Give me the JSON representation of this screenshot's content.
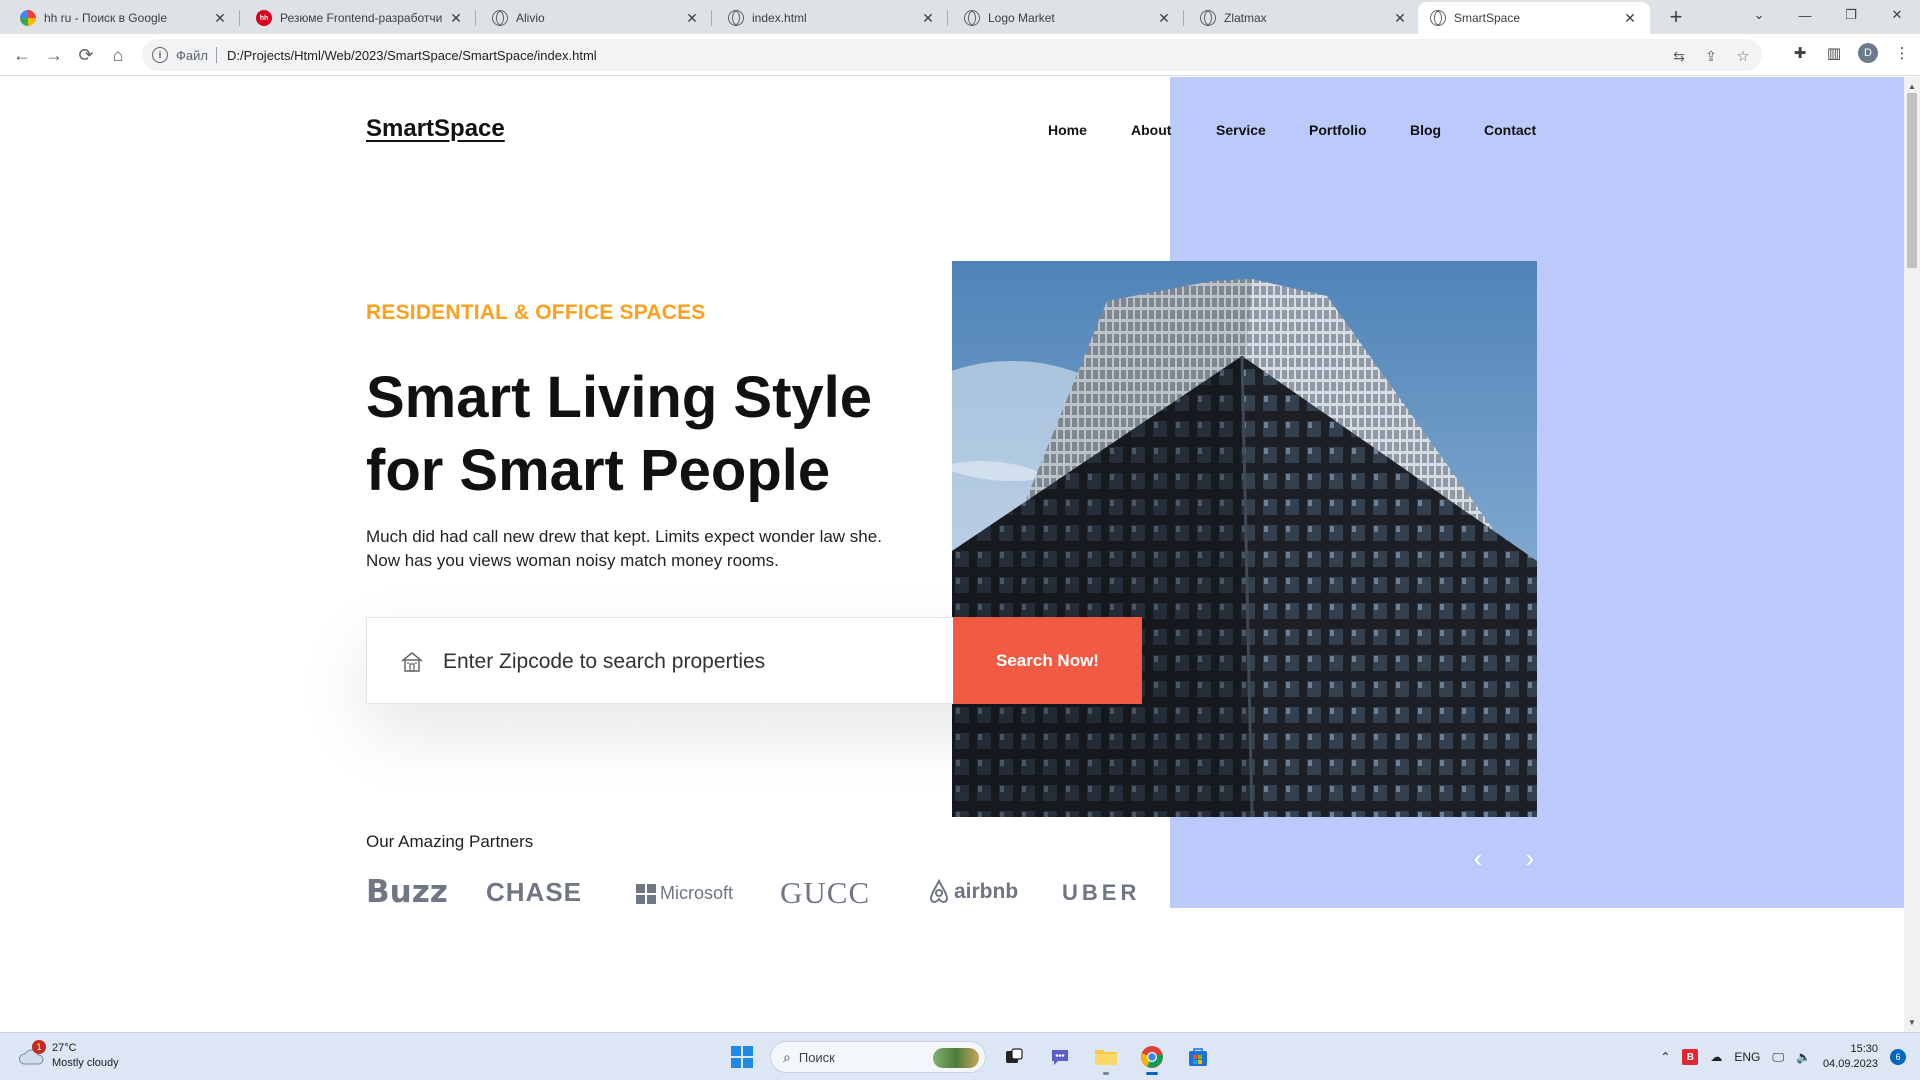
{
  "browser": {
    "tabs": [
      {
        "title": "hh ru - Поиск в Google",
        "favicon": "google"
      },
      {
        "title": "Резюме Frontend-разработчик",
        "favicon": "hh"
      },
      {
        "title": "Alivio",
        "favicon": "globe"
      },
      {
        "title": "index.html",
        "favicon": "globe"
      },
      {
        "title": "Logo Market",
        "favicon": "globe"
      },
      {
        "title": "Zlatmax",
        "favicon": "globe"
      },
      {
        "title": "SmartSpace",
        "favicon": "globe",
        "active": true
      }
    ],
    "address": {
      "scheme_label": "Файл",
      "url": "D:/Projects/Html/Web/2023/SmartSpace/SmartSpace/index.html"
    },
    "profile_initial": "D"
  },
  "site": {
    "logo": "SmartSpace",
    "nav": [
      "Home",
      "About",
      "Service",
      "Portfolio",
      "Blog",
      "Contact"
    ],
    "hero": {
      "eyebrow": "RESIDENTIAL & OFFICE SPACES",
      "title_line1": "Smart Living Style",
      "title_line2": "for Smart People",
      "sub_line1": "Much did had call new drew that kept. Limits expect wonder law she.",
      "sub_line2": "Now has you views woman noisy match money rooms."
    },
    "search": {
      "placeholder": "Enter Zipcode to search properties",
      "button": "Search Now!"
    },
    "partners": {
      "title": "Our Amazing Partners",
      "logos": [
        "Buzz",
        "CHASE",
        "Microsoft",
        "GUCC",
        "airbnb",
        "UBER"
      ]
    },
    "colors": {
      "accent_orange": "#ff9f1c",
      "button_red": "#f25a44",
      "lavender": "#bcc9fb"
    }
  },
  "taskbar": {
    "weather_temp": "27°C",
    "weather_desc": "Mostly cloudy",
    "weather_badge": "1",
    "search_placeholder": "Поиск",
    "lang": "ENG",
    "time": "15:30",
    "date": "04.09.2023",
    "notifications": "6"
  }
}
